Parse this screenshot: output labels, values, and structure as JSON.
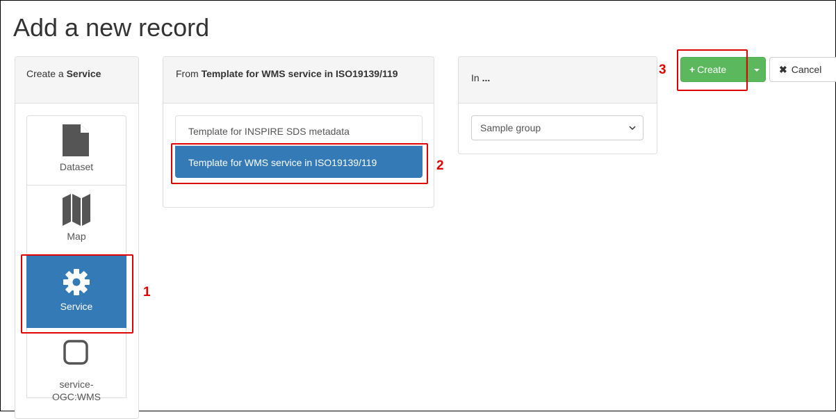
{
  "page": {
    "title": "Add a new record"
  },
  "type_panel": {
    "heading_prefix": "Create a",
    "heading_bold": "Service",
    "items": [
      {
        "label": "Dataset",
        "icon": "file-icon",
        "active": false
      },
      {
        "label": "Map",
        "icon": "map-icon",
        "active": false
      },
      {
        "label": "Service",
        "icon": "gear-icon",
        "active": true
      },
      {
        "label": "service-\nOGC:WMS",
        "label_line1": "service-",
        "label_line2": "OGC:WMS",
        "icon": "square-icon",
        "active": false
      }
    ]
  },
  "template_panel": {
    "heading_prefix": "From",
    "heading_bold": "Template for WMS service in ISO19139/119",
    "items": [
      {
        "label": "Template for INSPIRE SDS metadata",
        "active": false
      },
      {
        "label": "Template for WMS service in ISO19139/119",
        "active": true
      }
    ]
  },
  "group_panel": {
    "heading_prefix": "In",
    "heading_bold": "...",
    "select_value": "Sample group"
  },
  "actions": {
    "create_label": "Create",
    "cancel_label": "Cancel"
  },
  "annotations": [
    "1",
    "2",
    "3"
  ],
  "colors": {
    "primary": "#337ab7",
    "success": "#5cb85c",
    "annotation": "#e00000"
  }
}
